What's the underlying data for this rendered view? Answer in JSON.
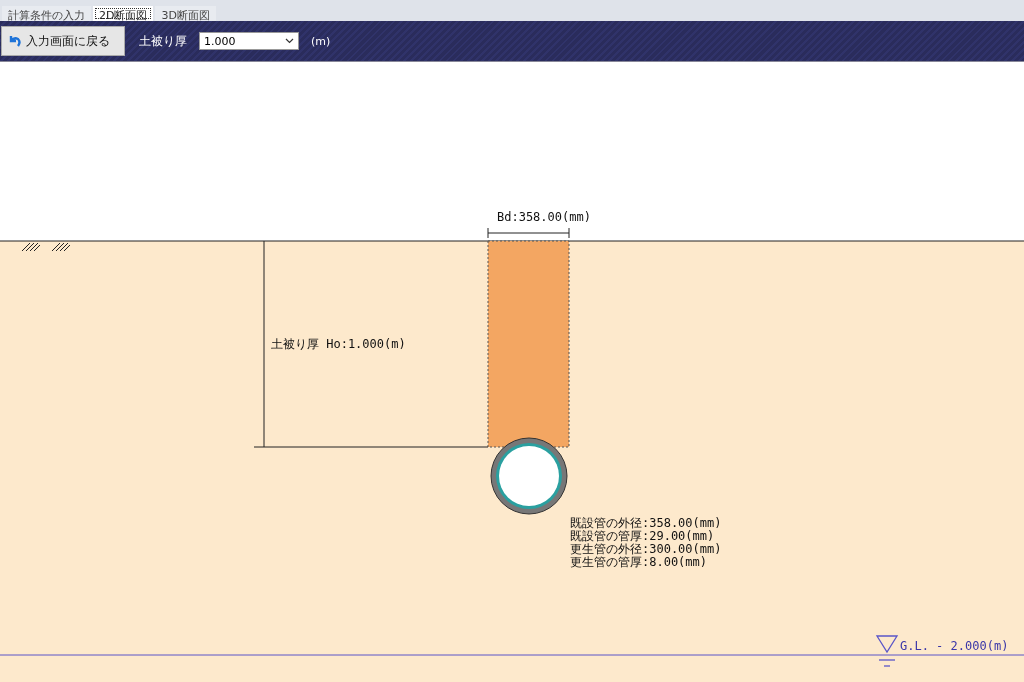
{
  "tabs": [
    {
      "label": "計算条件の入力",
      "selected": false
    },
    {
      "label": "2D断面図",
      "selected": true
    },
    {
      "label": "3D断面図",
      "selected": false
    }
  ],
  "toolbar": {
    "back_button": "入力画面に戻る",
    "cover_label": "土被り厚",
    "cover_value": "1.000",
    "unit": "(m)"
  },
  "drawing": {
    "width_label": "Bd:358.00(mm)",
    "cover_depth_label": "土被り厚 Ho:1.000(m)",
    "pipe_specs": [
      "既設管の外径:358.00(mm)",
      "既設管の管厚:29.00(mm)",
      "更生管の外径:300.00(mm)",
      "更生管の管厚:8.00(mm)"
    ],
    "water_level_label": "G.L. - 2.000(m)"
  }
}
